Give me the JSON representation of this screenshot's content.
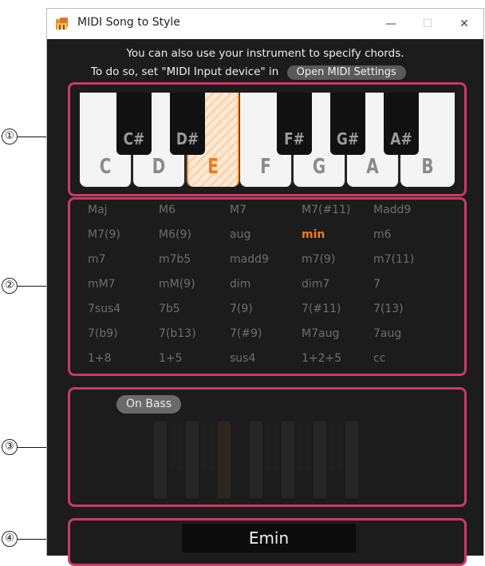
{
  "window": {
    "title": "MIDI Song to Style",
    "minimize_icon": "—",
    "maximize_icon": "☐",
    "close_icon": "✕"
  },
  "info": {
    "line1": "You can also use your instrument to specify chords.",
    "line2": "To do so, set \"MIDI Input device\" in",
    "open_settings_label": "Open MIDI Settings"
  },
  "keyboard": {
    "white_keys": [
      "C",
      "D",
      "E",
      "F",
      "G",
      "A",
      "B"
    ],
    "black_keys": [
      "C#",
      "D#",
      "F#",
      "G#",
      "A#"
    ],
    "selected_key": "E"
  },
  "chord_types": [
    [
      "Maj",
      "M6",
      "M7",
      "M7(#11)",
      "Madd9"
    ],
    [
      "M7(9)",
      "M6(9)",
      "aug",
      "min",
      "m6"
    ],
    [
      "m7",
      "m7b5",
      "madd9",
      "m7(9)",
      "m7(11)"
    ],
    [
      "mM7",
      "mM(9)",
      "dim",
      "dim7",
      "7"
    ],
    [
      "7sus4",
      "7b5",
      "7(9)",
      "7(#11)",
      "7(13)"
    ],
    [
      "7(b9)",
      "7(b13)",
      "7(#9)",
      "M7aug",
      "7aug"
    ],
    [
      "1+8",
      "1+5",
      "sus4",
      "1+2+5",
      "cc"
    ]
  ],
  "selected_chord_type": "min",
  "on_bass": {
    "label": "On Bass"
  },
  "chord_display": {
    "value": "Emin"
  },
  "callouts": [
    "①",
    "②",
    "③",
    "④"
  ],
  "colors": {
    "accent": "#f07a1a",
    "frame": "#c93a67",
    "background": "#1c1c1c"
  }
}
